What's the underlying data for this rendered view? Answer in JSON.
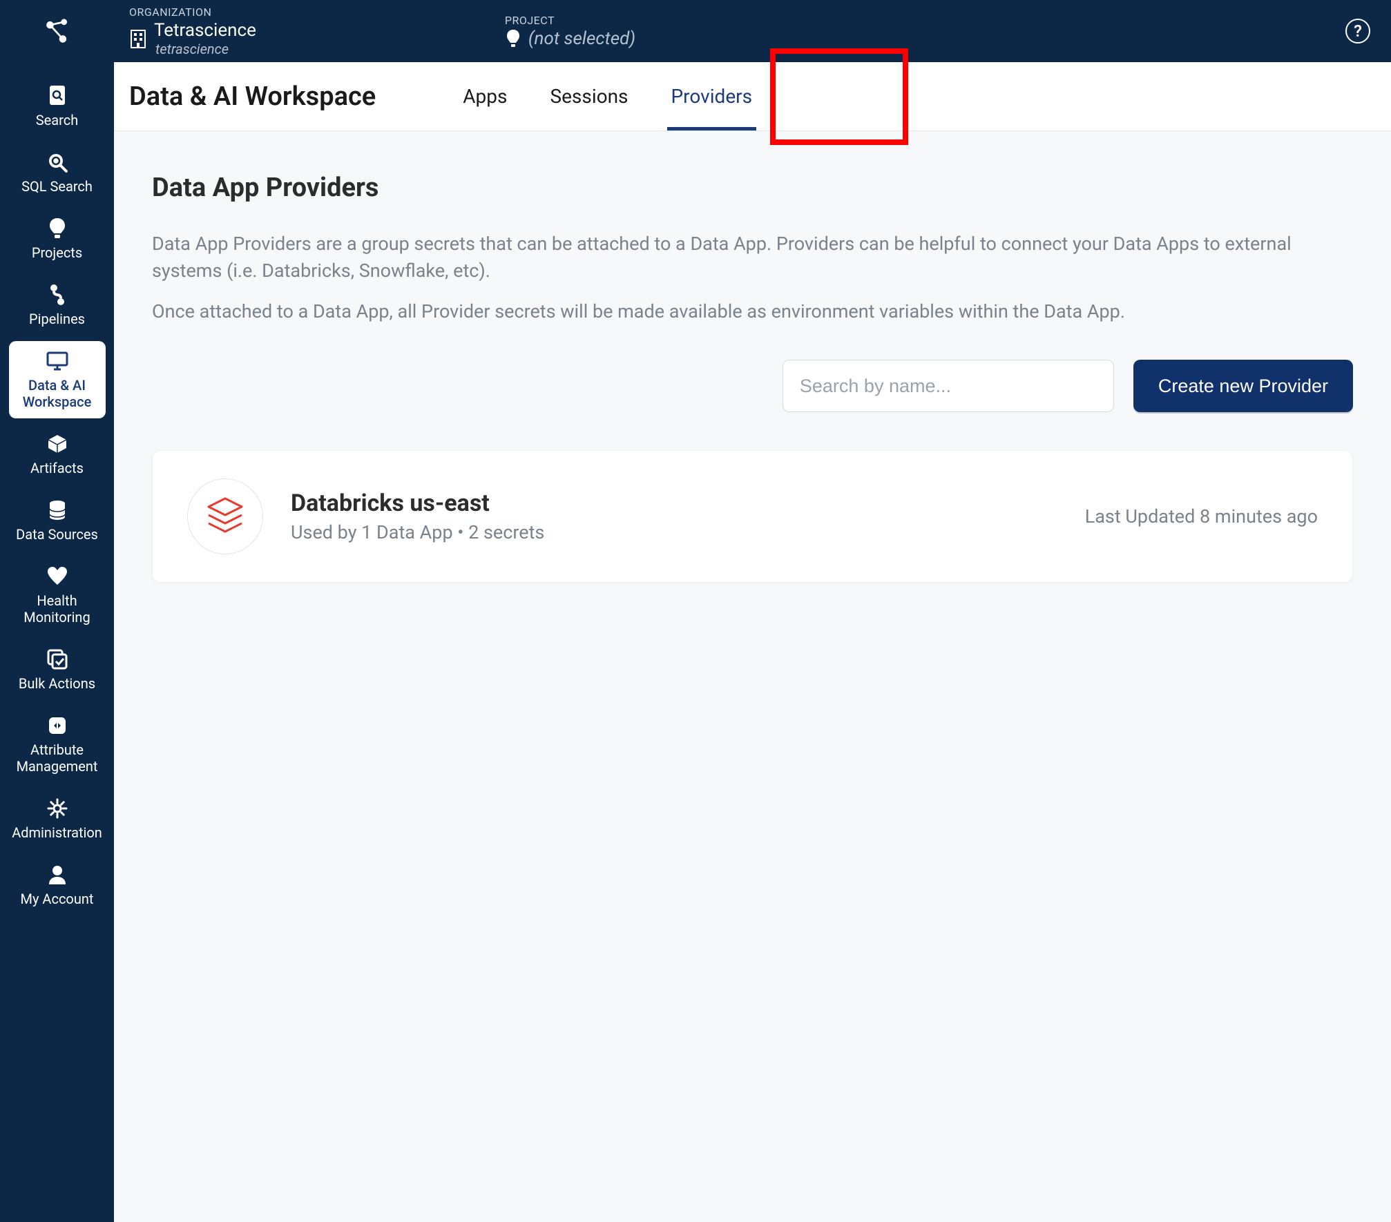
{
  "topbar": {
    "org_label": "ORGANIZATION",
    "org_name": "Tetrascience",
    "org_sub": "tetrascience",
    "project_label": "PROJECT",
    "project_value": "(not selected)"
  },
  "header": {
    "title": "Data & AI Workspace",
    "tabs": [
      {
        "label": "Apps",
        "active": false
      },
      {
        "label": "Sessions",
        "active": false
      },
      {
        "label": "Providers",
        "active": true
      }
    ]
  },
  "sidebar": {
    "items": [
      {
        "label": "Search",
        "icon": "document-search-icon"
      },
      {
        "label": "SQL Search",
        "icon": "sql-search-icon"
      },
      {
        "label": "Projects",
        "icon": "bulb-icon"
      },
      {
        "label": "Pipelines",
        "icon": "pipeline-icon"
      },
      {
        "label": "Data & AI Workspace",
        "icon": "monitor-icon",
        "active": true
      },
      {
        "label": "Artifacts",
        "icon": "cube-icon"
      },
      {
        "label": "Data Sources",
        "icon": "database-icon"
      },
      {
        "label": "Health Monitoring",
        "icon": "heart-monitor-icon"
      },
      {
        "label": "Bulk Actions",
        "icon": "bulk-icon"
      },
      {
        "label": "Attribute Management",
        "icon": "attribute-icon"
      },
      {
        "label": "Administration",
        "icon": "gear-icon"
      },
      {
        "label": "My Account",
        "icon": "user-icon"
      }
    ]
  },
  "content": {
    "title": "Data App Providers",
    "desc1": "Data App Providers are a group secrets that can be attached to a Data App. Providers can be helpful to connect your Data Apps to external systems (i.e. Databricks, Snowflake, etc).",
    "desc2": "Once attached to a Data App, all Provider secrets will be made available as environment variables within the Data App.",
    "search_placeholder": "Search by name...",
    "create_button": "Create new Provider",
    "providers": [
      {
        "name": "Databricks us-east",
        "meta": "Used by 1 Data App • 2 secrets",
        "updated": "Last Updated 8 minutes ago"
      }
    ]
  },
  "colors": {
    "navy": "#0d2847",
    "accent": "#1a3a7a",
    "red_highlight": "#ff0000",
    "databricks_red": "#e63c2f"
  }
}
